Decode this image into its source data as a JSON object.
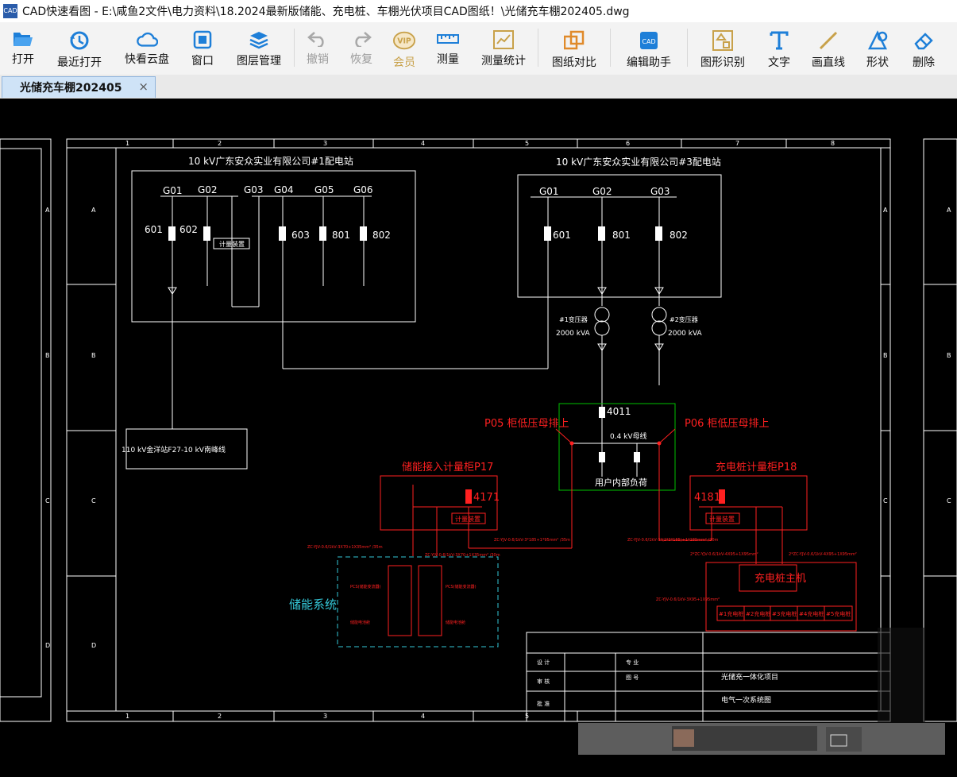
{
  "window": {
    "logo_text": "CAD",
    "title": "CAD快速看图 - E:\\咸鱼2文件\\电力资料\\18.2024最新版储能、充电桩、车棚光伏项目CAD图纸！\\光储充车棚202405.dwg"
  },
  "toolbar": {
    "open": "打开",
    "recent": "最近打开",
    "cloud": "快看云盘",
    "window": "窗口",
    "layers": "图层管理",
    "undo": "撤销",
    "redo": "恢复",
    "vip": "会员",
    "measure": "测量",
    "measure_stats": "测量统计",
    "compare": "图纸对比",
    "edit_assist": "编辑助手",
    "shape_recog": "图形识别",
    "text": "文字",
    "draw_line": "画直线",
    "shape": "形状",
    "delete": "删除"
  },
  "tab": {
    "label": "光储充车棚202405",
    "close": "×"
  },
  "colors": {
    "accent": "#1e7fd8",
    "cad_red": "#ff2020",
    "cad_green": "#00c000",
    "cad_cyan": "#35c8d8"
  },
  "drawing": {
    "col_numbers": [
      "1",
      "2",
      "3",
      "4",
      "5",
      "6",
      "7",
      "8"
    ],
    "row_letters": [
      "A",
      "B",
      "C",
      "D"
    ],
    "station1": {
      "title": "10 kV广东安众实业有限公司#1配电站",
      "bus_labels": [
        "G01",
        "G02",
        "G03",
        "G04",
        "G05",
        "G06"
      ],
      "switch_labels": [
        "601",
        "602",
        "603",
        "801",
        "802"
      ],
      "meter": "计量装置"
    },
    "station3": {
      "title": "10 kV广东安众实业有限公司#3配电站",
      "bus_labels": [
        "G01",
        "G02",
        "G03"
      ],
      "switch_labels": [
        "601",
        "801",
        "802"
      ]
    },
    "tr1": {
      "name": "#1变压器",
      "rating": "2000 kVA"
    },
    "tr2": {
      "name": "#2变压器",
      "rating": "2000 kVA"
    },
    "feeder": "110 kV金洋站F27-10 kV南峰线",
    "lv_panel": {
      "switch": "4011",
      "bus": "0.4 kV母线",
      "load": "用户内部负荷"
    },
    "p05": "P05 柜低压母排上",
    "p06": "P06 柜低压母排上",
    "storage_meter": {
      "title": "储能接入计量柜P17",
      "switch": "4171",
      "meter": "计量装置"
    },
    "charger_meter": {
      "title": "充电桩计量柜P18",
      "switch": "4181",
      "meter": "计量装置"
    },
    "storage_system": "储能系统",
    "charger_host": "充电桩主机",
    "chargers": [
      "#1充电桩",
      "#2充电桩",
      "#3充电桩",
      "#4充电桩",
      "#5充电桩"
    ],
    "small_notes": {
      "cable1": "ZC-YJV-0.6/1kV-3X70+1X35mm² /35m",
      "cable2": "ZC-YJV-0.6/1kV-3X70+1X35mm² /30m",
      "cable3": "ZC-YJV-0.6/1kV-3*185+1*95mm² /35m",
      "cable4": "ZC-YJV-0.6/1kV-3*(2*3*185)+1*185mm² /20m",
      "cable5": "2*ZC-YJV-0.6/1kV-4X95+1X95mm²",
      "cable6": "2*ZC-YJV-0.6/1kV-4X95+1X95mm²",
      "cable7": "ZC-YJV-0.6/1kV-3X95+1X95mm²",
      "pcs1": "PCS(储能变流器)",
      "pcs2": "PCS(储能变流器)",
      "batt1": "储能电池舱",
      "batt2": "储能电池舱"
    },
    "title_block": {
      "r1": "设 计",
      "r2": "审 核",
      "r3": "批 准",
      "r1b": "专 业",
      "r2b": "图 号",
      "project": "光储充一体化项目",
      "drawing_name": "电气一次系统图"
    }
  }
}
